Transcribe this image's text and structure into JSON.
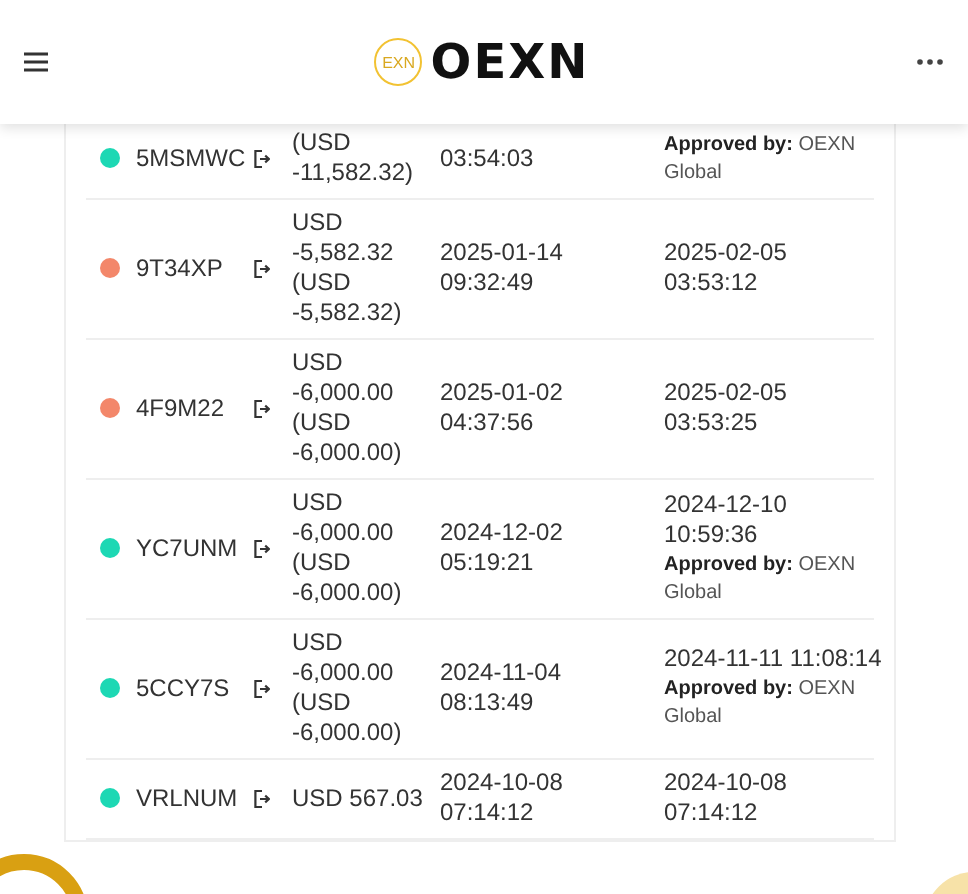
{
  "header": {
    "logo_text": "OEXN",
    "logo_badge": "EXN"
  },
  "rows": [
    {
      "id": "5MSMWC",
      "color": "#1dd8b4",
      "amount": [
        "(USD",
        "-11,582.32)"
      ],
      "created": [
        "03:54:03"
      ],
      "completed": [],
      "approval": "**Approved by:** OEXN Global"
    },
    {
      "id": "9T34XP",
      "color": "#f3876a",
      "amount": [
        "USD",
        "-5,582.32",
        "(USD",
        "-5,582.32)"
      ],
      "created": [
        "2025-01-14",
        "09:32:49"
      ],
      "completed": [
        "2025-02-05",
        "03:53:12"
      ]
    },
    {
      "id": "4F9M22",
      "color": "#f3876a",
      "amount": [
        "USD",
        "-6,000.00",
        "(USD",
        "-6,000.00)"
      ],
      "created": [
        "2025-01-02",
        "04:37:56"
      ],
      "completed": [
        "2025-02-05",
        "03:53:25"
      ]
    },
    {
      "id": "YC7UNM",
      "color": "#1dd8b4",
      "amount": [
        "USD",
        "-6,000.00",
        "(USD",
        "-6,000.00)"
      ],
      "created": [
        "2024-12-02",
        "05:19:21"
      ],
      "completed": [
        "2024-12-10",
        "10:59:36"
      ],
      "approval": "**Approved by:** OEXN Global"
    },
    {
      "id": "5CCY7S",
      "color": "#1dd8b4",
      "amount": [
        "USD",
        "-6,000.00",
        "(USD",
        "-6,000.00)"
      ],
      "created": [
        "2024-11-04",
        "08:13:49"
      ],
      "completed": [
        "2024-11-11 11:08:14"
      ],
      "approval": "**Approved by:** OEXN Global"
    },
    {
      "id": "VRLNUM",
      "color": "#1dd8b4",
      "amount": [
        "USD 567.03"
      ],
      "created": [
        "2024-10-08",
        "07:14:12"
      ],
      "completed": [
        "2024-10-08",
        "07:14:12"
      ]
    }
  ]
}
